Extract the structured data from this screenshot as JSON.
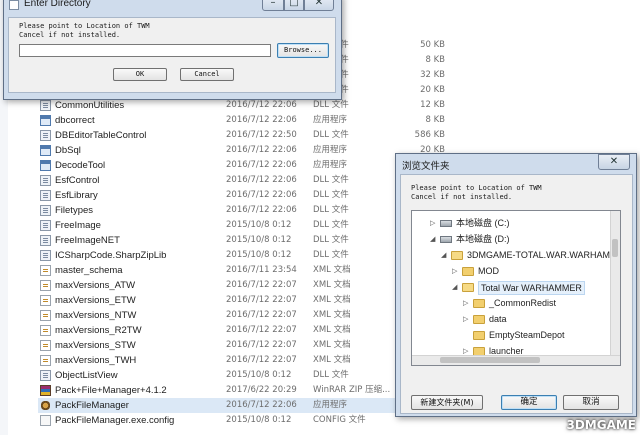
{
  "files": [
    {
      "name": "",
      "date": "",
      "type": "DLL 文件",
      "size": "50 KB",
      "icon": "dll-file-icon"
    },
    {
      "name": "",
      "date": "",
      "type": "DLL 文件",
      "size": "8 KB",
      "icon": "dll-file-icon"
    },
    {
      "name": "",
      "date": "",
      "type": "DLL 文件",
      "size": "32 KB",
      "icon": "dll-file-icon"
    },
    {
      "name": "",
      "date": "",
      "type": "DLL 文件",
      "size": "20 KB",
      "icon": "dll-file-icon"
    },
    {
      "name": "CommonUtilities",
      "date": "2016/7/12 22:06",
      "type": "DLL 文件",
      "size": "12 KB",
      "icon": "dll-file-icon"
    },
    {
      "name": "dbcorrect",
      "date": "2016/7/12 22:06",
      "type": "应用程序",
      "size": "8 KB",
      "icon": "exe-app-icon"
    },
    {
      "name": "DBEditorTableControl",
      "date": "2016/7/12 22:50",
      "type": "DLL 文件",
      "size": "586 KB",
      "icon": "dll-file-icon"
    },
    {
      "name": "DbSql",
      "date": "2016/7/12 22:06",
      "type": "应用程序",
      "size": "20 KB",
      "icon": "exe-app-icon"
    },
    {
      "name": "DecodeTool",
      "date": "2016/7/12 22:06",
      "type": "应用程序",
      "size": "",
      "icon": "exe-app-icon"
    },
    {
      "name": "EsfControl",
      "date": "2016/7/12 22:06",
      "type": "DLL 文件",
      "size": "",
      "icon": "dll-file-icon"
    },
    {
      "name": "EsfLibrary",
      "date": "2016/7/12 22:06",
      "type": "DLL 文件",
      "size": "",
      "icon": "dll-file-icon"
    },
    {
      "name": "Filetypes",
      "date": "2016/7/12 22:06",
      "type": "DLL 文件",
      "size": "",
      "icon": "dll-file-icon"
    },
    {
      "name": "FreeImage",
      "date": "2015/10/8 0:12",
      "type": "DLL 文件",
      "size": "",
      "icon": "dll-file-icon"
    },
    {
      "name": "FreeImageNET",
      "date": "2015/10/8 0:12",
      "type": "DLL 文件",
      "size": "",
      "icon": "dll-file-icon"
    },
    {
      "name": "ICSharpCode.SharpZipLib",
      "date": "2015/10/8 0:12",
      "type": "DLL 文件",
      "size": "",
      "icon": "dll-file-icon"
    },
    {
      "name": "master_schema",
      "date": "2016/7/11 23:54",
      "type": "XML 文档",
      "size": "",
      "icon": "xml-file-icon"
    },
    {
      "name": "maxVersions_ATW",
      "date": "2016/7/12 22:07",
      "type": "XML 文档",
      "size": "",
      "icon": "xml-file-icon"
    },
    {
      "name": "maxVersions_ETW",
      "date": "2016/7/12 22:07",
      "type": "XML 文档",
      "size": "",
      "icon": "xml-file-icon"
    },
    {
      "name": "maxVersions_NTW",
      "date": "2016/7/12 22:07",
      "type": "XML 文档",
      "size": "",
      "icon": "xml-file-icon"
    },
    {
      "name": "maxVersions_R2TW",
      "date": "2016/7/12 22:07",
      "type": "XML 文档",
      "size": "",
      "icon": "xml-file-icon"
    },
    {
      "name": "maxVersions_STW",
      "date": "2016/7/12 22:07",
      "type": "XML 文档",
      "size": "",
      "icon": "xml-file-icon"
    },
    {
      "name": "maxVersions_TWH",
      "date": "2016/7/12 22:07",
      "type": "XML 文档",
      "size": "",
      "icon": "xml-file-icon"
    },
    {
      "name": "ObjectListView",
      "date": "2015/10/8 0:12",
      "type": "DLL 文件",
      "size": "",
      "icon": "dll-file-icon"
    },
    {
      "name": "Pack+File+Manager+4.1.2",
      "date": "2017/6/22 20:29",
      "type": "WinRAR ZIP 压缩...",
      "size": "",
      "icon": "winrar-archive-icon"
    },
    {
      "name": "PackFileManager",
      "date": "2016/7/12 22:06",
      "type": "应用程序",
      "size": "",
      "icon": "packfilemanager-app-icon",
      "selected": true
    },
    {
      "name": "PackFileManager.exe.config",
      "date": "2015/10/8 0:12",
      "type": "CONFIG 文件",
      "size": "",
      "icon": "config-file-icon"
    }
  ],
  "enter_dialog": {
    "title": "Enter Directory",
    "prompt_line1": "Please point to Location of TWM",
    "prompt_line2": "Cancel if not installed.",
    "path_value": "",
    "browse_label": "Browse...",
    "ok_label": "OK",
    "cancel_label": "Cancel"
  },
  "browse_dialog": {
    "title": "浏览文件夹",
    "close_glyph": "✕",
    "prompt_line1": "Please point to Location of TWM",
    "prompt_line2": "Cancel if not installed.",
    "tree": [
      {
        "label": "本地磁盘 (C:)",
        "indent": 0,
        "twisty": "▷",
        "kind": "drive",
        "name": "tree-drive-c"
      },
      {
        "label": "本地磁盘 (D:)",
        "indent": 0,
        "twisty": "◢",
        "kind": "drive",
        "name": "tree-drive-d"
      },
      {
        "label": "3DMGAME-TOTAL.WAR.WARHAMMER",
        "indent": 1,
        "twisty": "◢",
        "kind": "folder-open",
        "name": "tree-folder-3dmgame"
      },
      {
        "label": "MOD",
        "indent": 2,
        "twisty": "▷",
        "kind": "folder",
        "name": "tree-folder-mod"
      },
      {
        "label": "Total War WARHAMMER",
        "indent": 2,
        "twisty": "◢",
        "kind": "folder-open",
        "name": "tree-folder-total-war-warhammer",
        "highlight": true
      },
      {
        "label": "_CommonRedist",
        "indent": 3,
        "twisty": "▷",
        "kind": "folder",
        "name": "tree-folder-commonredist"
      },
      {
        "label": "data",
        "indent": 3,
        "twisty": "▷",
        "kind": "folder",
        "name": "tree-folder-data"
      },
      {
        "label": "EmptySteamDepot",
        "indent": 3,
        "twisty": "",
        "kind": "folder",
        "name": "tree-folder-emptysteamdepot"
      },
      {
        "label": "launcher",
        "indent": 3,
        "twisty": "▷",
        "kind": "folder",
        "name": "tree-folder-launcher"
      }
    ],
    "new_folder_label": "新建文件夹(M)",
    "confirm_label": "确定",
    "cancel_label": "取消"
  },
  "watermark": "3DMGAME"
}
